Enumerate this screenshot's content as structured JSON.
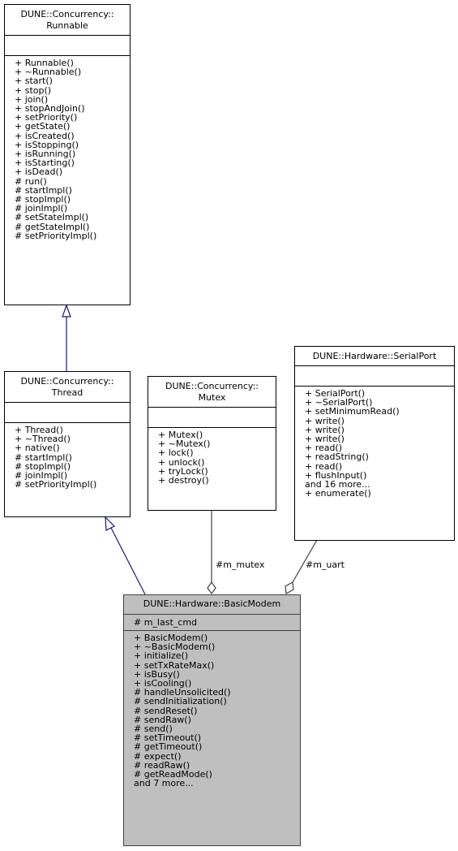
{
  "diagram": {
    "type": "uml-collaboration-diagram",
    "classes": {
      "runnable": {
        "name": "DUNE::Concurrency::\nRunnable",
        "attributes": [],
        "methods": [
          "+ Runnable()",
          "+ ~Runnable()",
          "+ start()",
          "+ stop()",
          "+ join()",
          "+ stopAndJoin()",
          "+ setPriority()",
          "+ getState()",
          "+ isCreated()",
          "+ isStopping()",
          "+ isRunning()",
          "+ isStarting()",
          "+ isDead()",
          "# run()",
          "# startImpl()",
          "# stopImpl()",
          "# joinImpl()",
          "# setStateImpl()",
          "# getStateImpl()",
          "# setPriorityImpl()"
        ]
      },
      "thread": {
        "name": "DUNE::Concurrency::\nThread",
        "attributes": [],
        "methods": [
          "+ Thread()",
          "+ ~Thread()",
          "+ native()",
          "# startImpl()",
          "# stopImpl()",
          "# joinImpl()",
          "# setPriorityImpl()"
        ]
      },
      "mutex": {
        "name": "DUNE::Concurrency::\nMutex",
        "attributes": [],
        "methods": [
          "+ Mutex()",
          "+ ~Mutex()",
          "+ lock()",
          "+ unlock()",
          "+ tryLock()",
          "+ destroy()"
        ]
      },
      "serialport": {
        "name": "DUNE::Hardware::SerialPort",
        "attributes": [],
        "methods": [
          "+ SerialPort()",
          "+ ~SerialPort()",
          "+ setMinimumRead()",
          "+ write()",
          "+ write()",
          "+ write()",
          "+ read()",
          "+ readString()",
          "+ read()",
          "+ flushInput()",
          "and 16 more...",
          "+ enumerate()"
        ]
      },
      "basicmodem": {
        "name": "DUNE::Hardware::BasicModem",
        "attributes": [
          "# m_last_cmd"
        ],
        "methods": [
          "+ BasicModem()",
          "+ ~BasicModem()",
          "+ initialize()",
          "+ setTxRateMax()",
          "+ isBusy()",
          "+ isCooling()",
          "# handleUnsolicited()",
          "# sendInitialization()",
          "# sendReset()",
          "# sendRaw()",
          "# send()",
          "# setTimeout()",
          "# getTimeout()",
          "# expect()",
          "# readRaw()",
          "# getReadMode()",
          "and 7 more..."
        ]
      }
    },
    "relations": [
      {
        "from": "thread",
        "to": "runnable",
        "kind": "inheritance",
        "color": "#191970"
      },
      {
        "from": "basicmodem",
        "to": "thread",
        "kind": "inheritance",
        "color": "#191970"
      },
      {
        "from": "basicmodem",
        "to": "mutex",
        "kind": "aggregation",
        "label": "#m_mutex",
        "color": "#404040"
      },
      {
        "from": "basicmodem",
        "to": "serialport",
        "kind": "aggregation",
        "label": "#m_uart",
        "color": "#404040"
      }
    ]
  }
}
